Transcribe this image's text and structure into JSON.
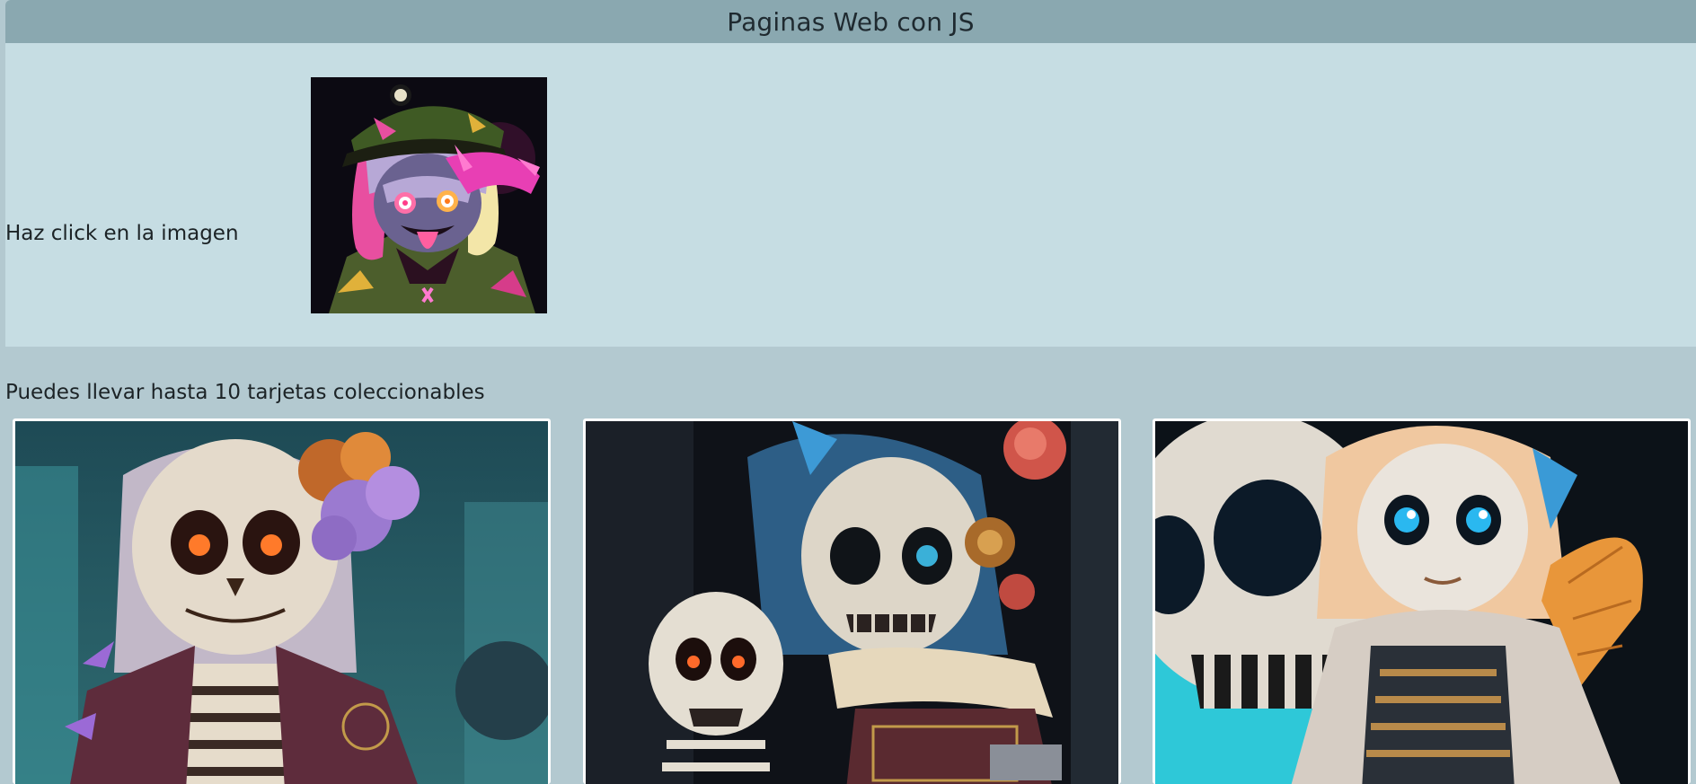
{
  "header": {
    "title": "Paginas Web con JS"
  },
  "hero": {
    "label": "Haz click en la imagen",
    "image_subject": "anime character with military cap and pink hand",
    "image_icon": "anime-portrait-image"
  },
  "collection": {
    "label": "Puedes llevar hasta 10 tarjetas coleccionables",
    "cards": [
      {
        "icon": "skeleton-girl-purple-flowers-image"
      },
      {
        "icon": "skeleton-couple-roses-image"
      },
      {
        "icon": "chibi-skeleton-with-giant-skull-image"
      }
    ]
  },
  "colors": {
    "header_bg": "#8aa8b0",
    "hero_bg": "#c6dde3",
    "page_bg": "#b3c9d0",
    "card_border": "#ffffff"
  }
}
